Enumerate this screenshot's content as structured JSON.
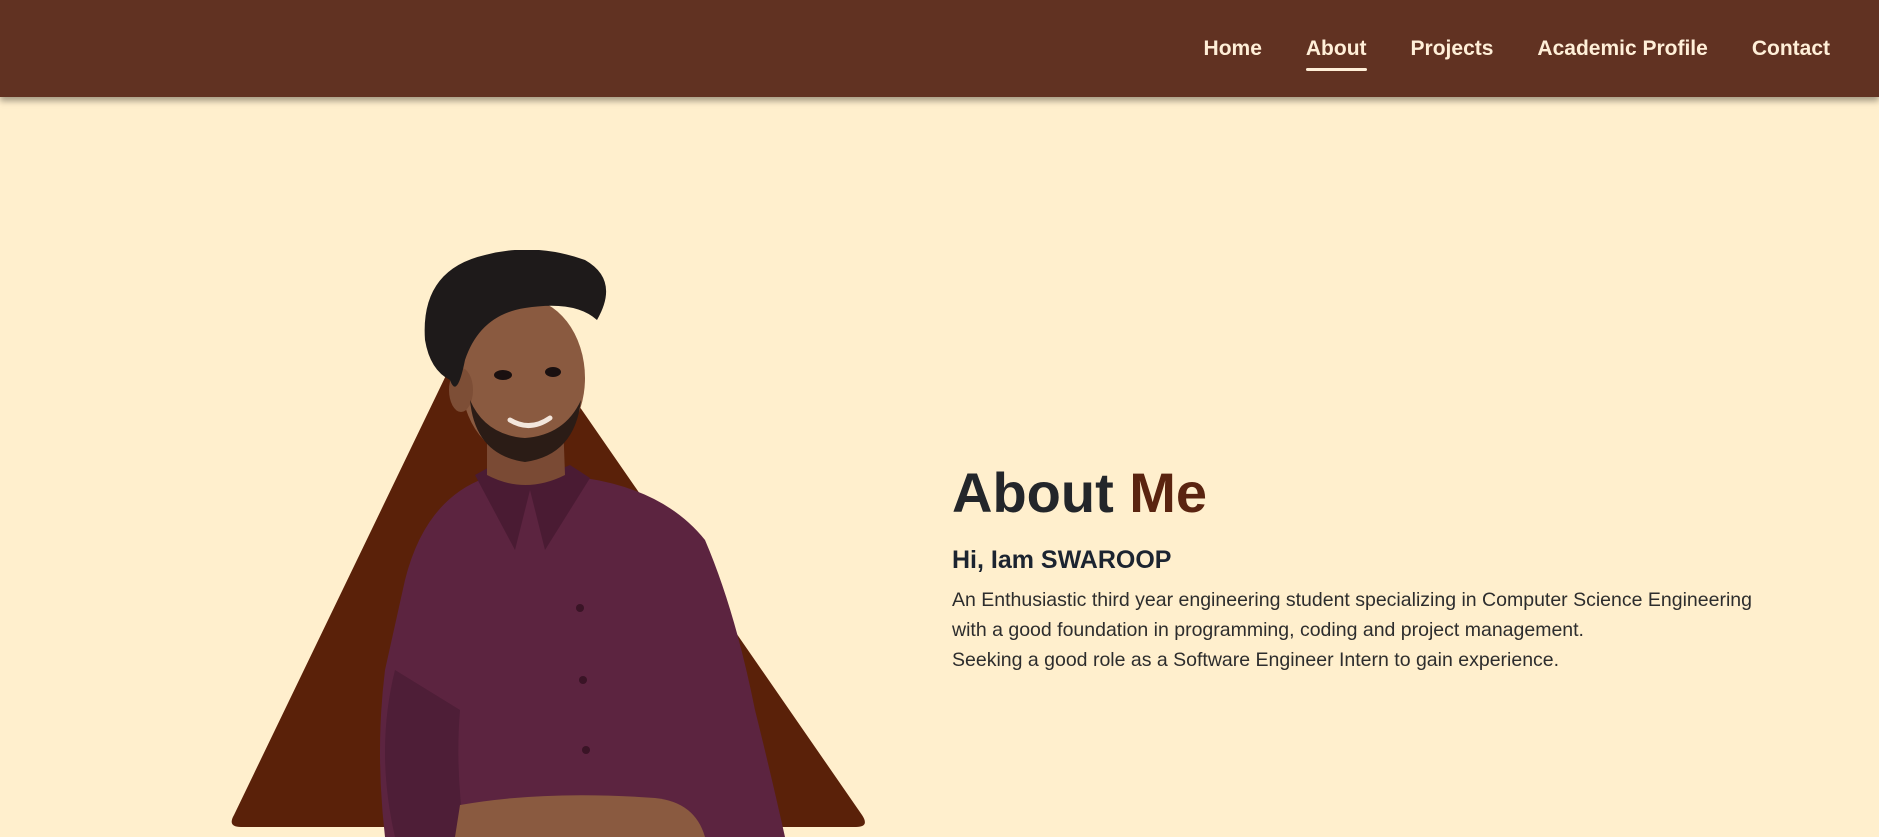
{
  "nav": {
    "links": [
      {
        "label": "Home",
        "active": false
      },
      {
        "label": "About",
        "active": true
      },
      {
        "label": "Projects",
        "active": false
      },
      {
        "label": "Academic Profile",
        "active": false
      },
      {
        "label": "Contact",
        "active": false
      }
    ]
  },
  "about": {
    "title_prefix": "About",
    "title_accent": "Me",
    "greeting": "Hi, Iam SWAROOP",
    "bio_line1": "An Enthusiastic third year engineering student specializing in Computer Science Engineering",
    "bio_line2": "with a good foundation in programming, coding and project management.",
    "bio_line3": "Seeking a good role as a Software Engineer Intern to gain experience."
  },
  "colors": {
    "navbar": "#613222",
    "background": "#ffefcd",
    "triangle": "#5a2109",
    "accent": "#5a2410",
    "shirt": "#5c2440"
  },
  "images": {
    "profile_photo": "portrait-photo"
  }
}
